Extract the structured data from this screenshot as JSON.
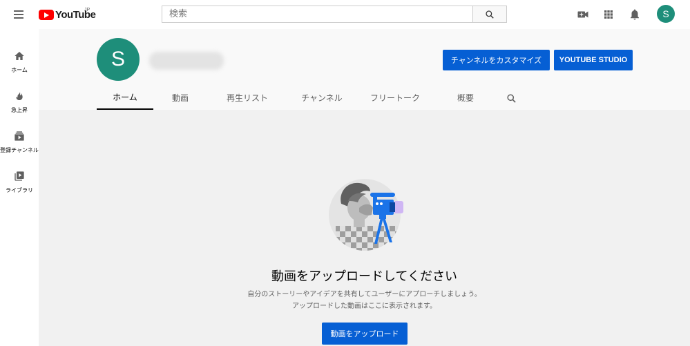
{
  "header": {
    "logo_text": "YouTube",
    "logo_region": "JP",
    "search_placeholder": "検索",
    "user_initial": "S"
  },
  "sidebar": {
    "items": [
      {
        "label": "ホーム",
        "icon": "home-icon"
      },
      {
        "label": "急上昇",
        "icon": "flame-icon"
      },
      {
        "label": "登録チャンネル",
        "icon": "subscriptions-icon"
      },
      {
        "label": "ライブラリ",
        "icon": "library-icon"
      }
    ]
  },
  "channel": {
    "avatar_initial": "S",
    "customize_label": "チャンネルをカスタマイズ",
    "studio_label": "YOUTUBE STUDIO",
    "tabs": [
      {
        "label": "ホーム",
        "active": true
      },
      {
        "label": "動画",
        "active": false
      },
      {
        "label": "再生リスト",
        "active": false
      },
      {
        "label": "チャンネル",
        "active": false
      },
      {
        "label": "フリートーク",
        "active": false
      },
      {
        "label": "概要",
        "active": false
      }
    ]
  },
  "main": {
    "title": "動画をアップロードしてください",
    "description_line1": "自分のストーリーやアイデアを共有してユーザーにアプローチしましょう。",
    "description_line2": "アップロードした動画はここに表示されます。",
    "upload_button": "動画をアップロード"
  },
  "colors": {
    "brand_red": "#ff0000",
    "accent_blue": "#065fd4",
    "avatar_teal": "#1e8e7a"
  }
}
